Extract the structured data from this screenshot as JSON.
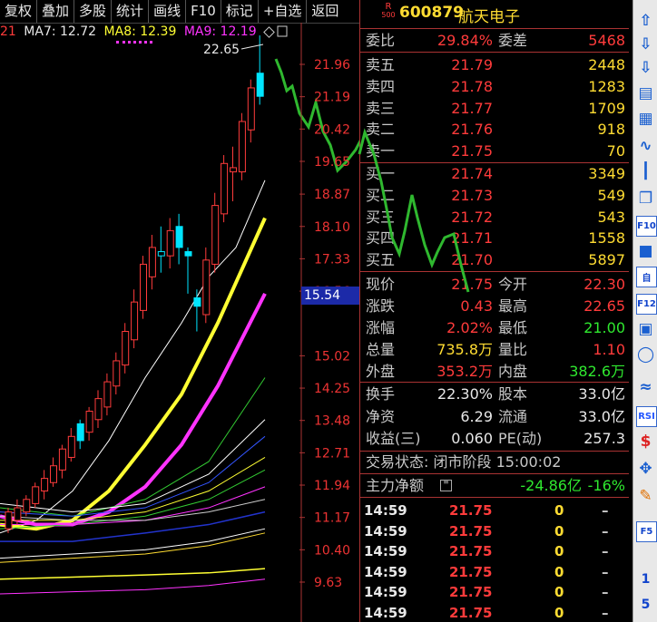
{
  "toolbar": {
    "items": [
      "复权",
      "叠加",
      "多股",
      "统计",
      "画线",
      "F10",
      "标记",
      "+自选",
      "返回"
    ]
  },
  "ma_legend": {
    "lead": "21",
    "ma7": "MA7: 12.72",
    "ma8": "MA8: 12.39",
    "ma9": "MA9: 12.19"
  },
  "chart": {
    "high_label": "22.65",
    "y_ticks": [
      "21.96",
      "21.19",
      "20.42",
      "19.65",
      "18.87",
      "18.10",
      "17.33",
      "16.56",
      "15.02",
      "14.25",
      "13.48",
      "12.71",
      "11.94",
      "11.17",
      "10.40",
      "9.63"
    ],
    "current_price": "15.54",
    "colors": {
      "up": "#ff3b3b",
      "flat": "#00e5ff",
      "ma1": "#ffffff",
      "ma2": "#ffff33",
      "ma3": "#ff33ff",
      "ma4": "#33cc33",
      "overlay": "#2fb82f"
    }
  },
  "header": {
    "badge_top": "R",
    "badge_bottom": "500",
    "code": "600879",
    "name": "航天电子"
  },
  "ratio": {
    "label1": "委比",
    "value1": "29.84%",
    "label2": "委差",
    "value2": "5468"
  },
  "asks": [
    {
      "label": "卖五",
      "price": "21.79",
      "vol": "2448"
    },
    {
      "label": "卖四",
      "price": "21.78",
      "vol": "1283"
    },
    {
      "label": "卖三",
      "price": "21.77",
      "vol": "1709"
    },
    {
      "label": "卖二",
      "price": "21.76",
      "vol": "918"
    },
    {
      "label": "卖一",
      "price": "21.75",
      "vol": "70"
    }
  ],
  "bids": [
    {
      "label": "买一",
      "price": "21.74",
      "vol": "3349"
    },
    {
      "label": "买二",
      "price": "21.73",
      "vol": "549"
    },
    {
      "label": "买三",
      "price": "21.72",
      "vol": "543"
    },
    {
      "label": "买四",
      "price": "21.71",
      "vol": "1558"
    },
    {
      "label": "买五",
      "price": "21.70",
      "vol": "5897"
    }
  ],
  "quote": [
    {
      "l1": "现价",
      "v1": "21.75",
      "l2": "今开",
      "v2": "22.30"
    },
    {
      "l1": "涨跌",
      "v1": "0.43",
      "l2": "最高",
      "v2": "22.65"
    },
    {
      "l1": "涨幅",
      "v1": "2.02%",
      "l2": "最低",
      "v2": "21.00"
    },
    {
      "l1": "总量",
      "v1": "735.8万",
      "l2": "量比",
      "v2": "1.10"
    },
    {
      "l1": "外盘",
      "v1": "353.2万",
      "l2": "内盘",
      "v2": "382.6万"
    }
  ],
  "fund": [
    {
      "l1": "换手",
      "v1": "22.30%",
      "l2": "股本",
      "v2": "33.0亿"
    },
    {
      "l1": "净资",
      "v1": "6.29",
      "l2": "流通",
      "v2": "33.0亿"
    },
    {
      "l1": "收益(三)",
      "v1": "0.060",
      "l2": "PE(动)",
      "v2": "257.3"
    }
  ],
  "status": {
    "text": "交易状态: 闭市阶段 15:00:02"
  },
  "mainflow": {
    "label": "主力净额",
    "amount": "-24.86亿",
    "pct": "-16%"
  },
  "trades": [
    {
      "time": "14:59",
      "price": "21.75",
      "vol": "0",
      "side": "–"
    },
    {
      "time": "14:59",
      "price": "21.75",
      "vol": "0",
      "side": "–"
    },
    {
      "time": "14:59",
      "price": "21.75",
      "vol": "0",
      "side": "–"
    },
    {
      "time": "14:59",
      "price": "21.75",
      "vol": "0",
      "side": "–"
    },
    {
      "time": "14:59",
      "price": "21.75",
      "vol": "0",
      "side": "–"
    },
    {
      "time": "14:59",
      "price": "21.75",
      "vol": "0",
      "side": "–"
    }
  ],
  "sidebar": {
    "icons": [
      "arrow-up-icon",
      "arrow-down-icon",
      "arrow-down-icon",
      "report-icon",
      "grid-icon",
      "line-chart-icon",
      "candle-chart-icon",
      "windows-icon",
      "f10-icon",
      "company-icon",
      "self-icon",
      "f12-icon",
      "stats-icon",
      "circle-icon",
      "wave-icon",
      "rsi-icon",
      "dollar-icon",
      "move-icon",
      "pen-icon",
      "f5-icon"
    ],
    "labels": {
      "rsi": "RSI",
      "f10": "F10",
      "f12": "F12",
      "f5": "F5",
      "zi": "自",
      "n1": "1",
      "n5": "5"
    }
  }
}
